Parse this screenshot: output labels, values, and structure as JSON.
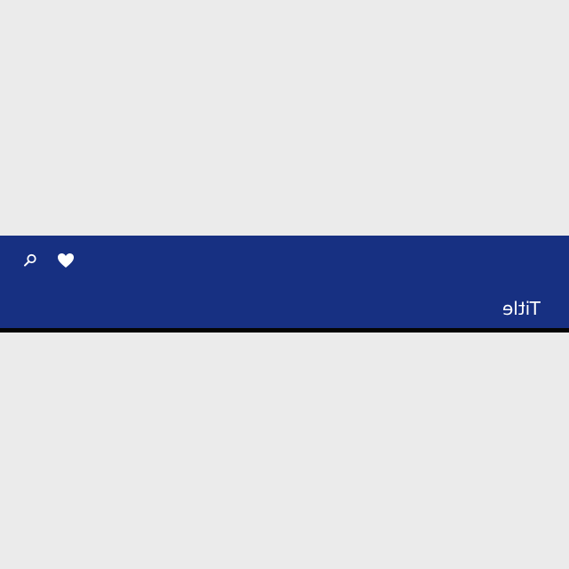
{
  "app_bar": {
    "title": "Title",
    "background_color": "#173082",
    "bottom_shadow_color": "#050505",
    "actions": [
      {
        "icon": "search-icon"
      },
      {
        "icon": "heart-icon"
      }
    ]
  },
  "page": {
    "background_color": "#ebebeb"
  }
}
